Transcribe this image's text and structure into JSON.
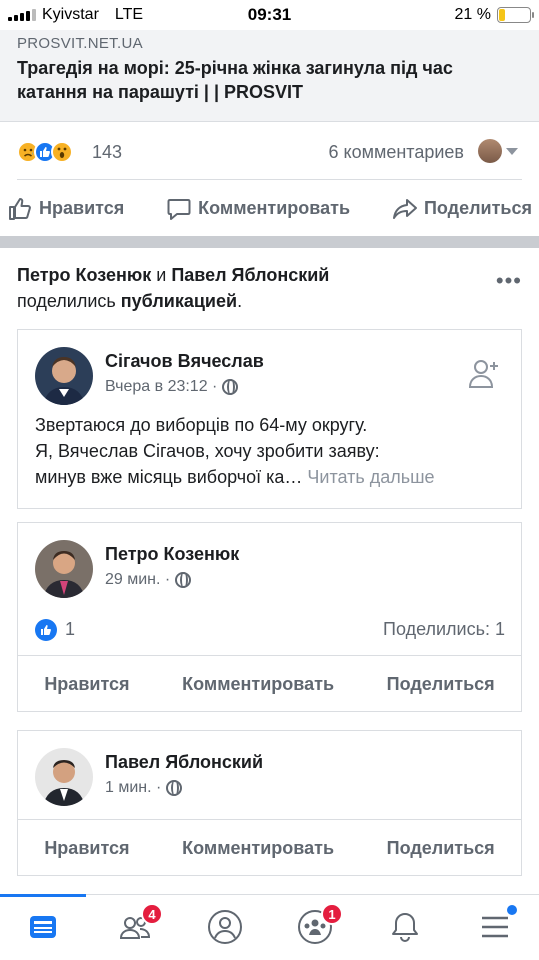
{
  "status": {
    "carrier": "Kyivstar",
    "network": "LTE",
    "time": "09:31",
    "battery_pct": "21 %",
    "battery_level": 0.21
  },
  "link_preview": {
    "domain": "PROSVIT.NET.UA",
    "title": "Трагедія на морі: 25-річна жінка загинула під час катання на парашуті | | PROSVIT"
  },
  "reactions": {
    "icons": [
      "sad-reaction-icon",
      "like-reaction-icon",
      "wow-reaction-icon"
    ],
    "count": "143",
    "comments": "6 комментариев"
  },
  "actions": {
    "like": "Нравится",
    "comment": "Комментировать",
    "share": "Поделиться"
  },
  "shared_header": {
    "user1": "Петро Козенюк",
    "conj": " и ",
    "user2": "Павел Яблонский",
    "line2_pre": "поделились ",
    "line2_bold": "публикацией",
    "line2_end": "."
  },
  "original_post": {
    "author": "Сігачов Вячеслав",
    "time": "Вчера в 23:12 ·",
    "text_1": "Звертаюся до виборців по 64-му округу.",
    "text_2": "Я, Вячеслав Сігачов, хочу зробити заяву:",
    "text_3": "минув вже місяць виборчої ка…",
    "read_more": " Читать дальше"
  },
  "share_1": {
    "author": "Петро Козенюк",
    "time": "29 мин. ·",
    "likes": "1",
    "shares": "Поделились: 1",
    "like": "Нравится",
    "comment": "Комментировать",
    "share": "Поделиться"
  },
  "share_2": {
    "author": "Павел Яблонский",
    "time": "1 мин. ·",
    "like": "Нравится",
    "comment": "Комментировать",
    "share": "Поделиться"
  },
  "nav": {
    "friends_badge": "4",
    "groups_badge": "1"
  },
  "colors": {
    "accent": "#1877f2",
    "badge": "#e41e3f",
    "text_muted": "#606770"
  }
}
